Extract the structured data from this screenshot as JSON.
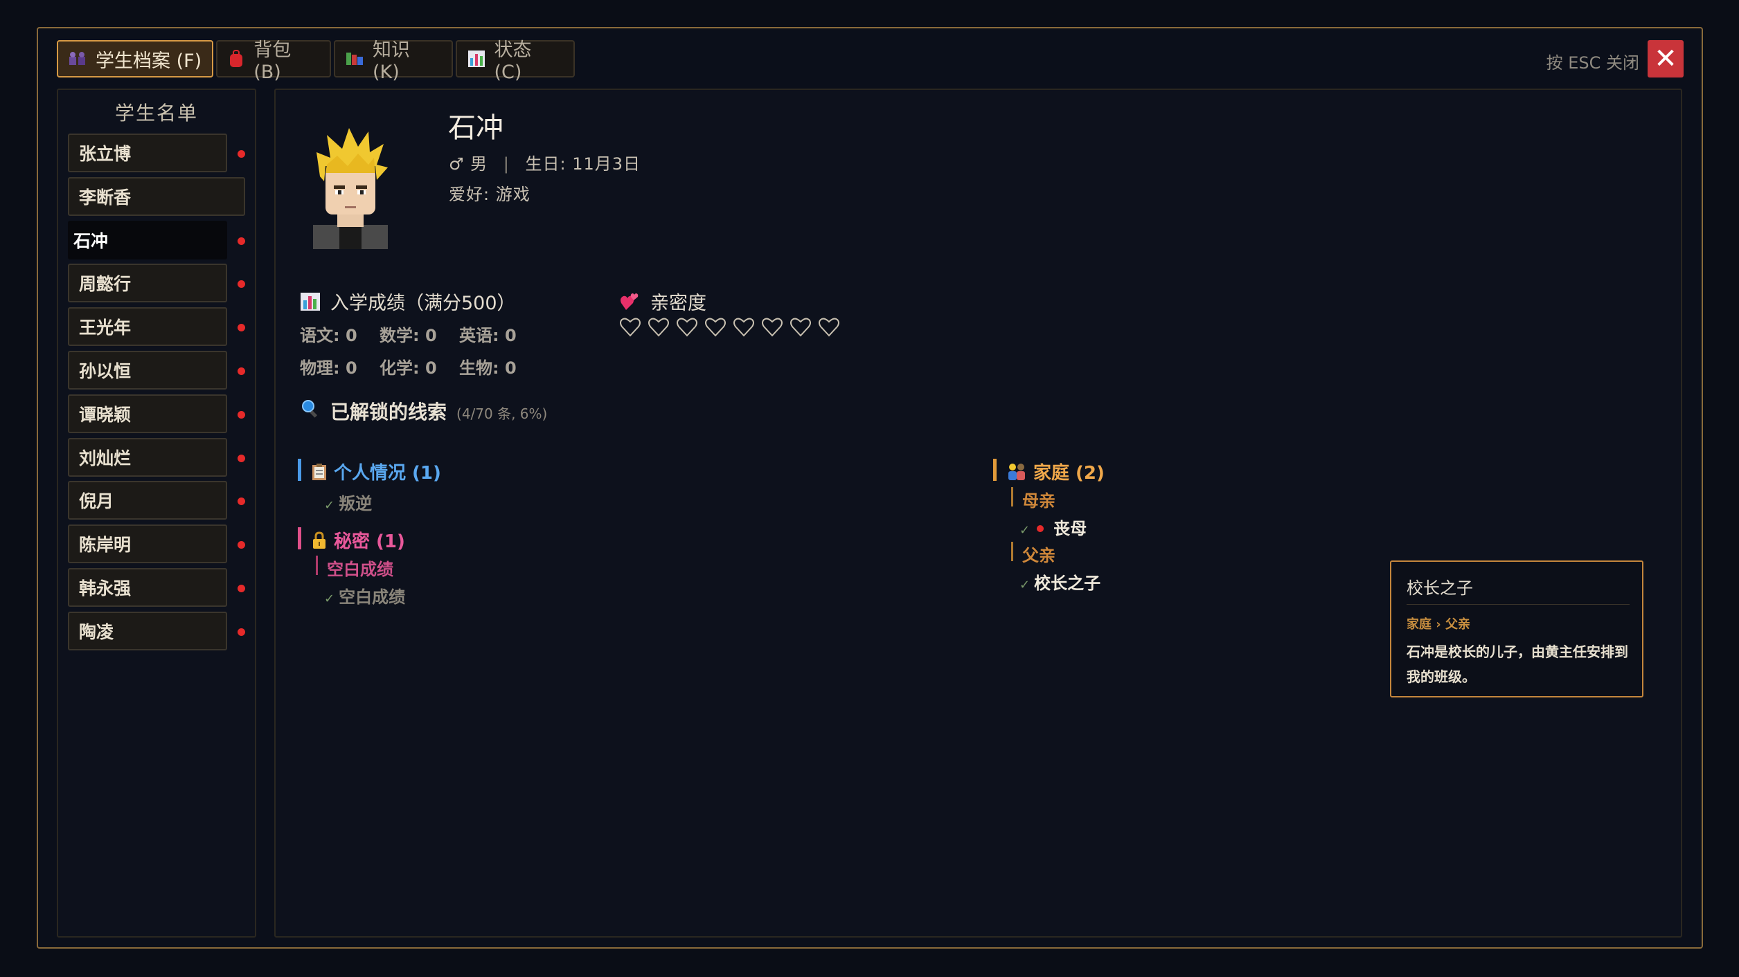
{
  "tabs": [
    {
      "label": "学生档案 (F)",
      "icon": "students-icon",
      "active": true
    },
    {
      "label": "背包 (B)",
      "icon": "backpack-icon",
      "active": false
    },
    {
      "label": "知识 (K)",
      "icon": "books-icon",
      "active": false
    },
    {
      "label": "状态 (C)",
      "icon": "chart-icon",
      "active": false
    }
  ],
  "esc_hint": "按 ESC 关闭",
  "close_icon": "✕",
  "sidebar": {
    "title": "学生名单",
    "students": [
      {
        "name": "张立博",
        "dot": true
      },
      {
        "name": "李断香",
        "dot": false
      },
      {
        "name": "石冲",
        "dot": true,
        "selected": true
      },
      {
        "name": "周懿行",
        "dot": true
      },
      {
        "name": "王光年",
        "dot": true
      },
      {
        "name": "孙以恒",
        "dot": true
      },
      {
        "name": "谭晓颖",
        "dot": true
      },
      {
        "name": "刘灿烂",
        "dot": true
      },
      {
        "name": "倪月",
        "dot": true
      },
      {
        "name": "陈岸明",
        "dot": true
      },
      {
        "name": "韩永强",
        "dot": true
      },
      {
        "name": "陶凌",
        "dot": true
      }
    ]
  },
  "profile": {
    "name": "石冲",
    "gender_symbol": "♂",
    "gender": "男",
    "birthday": "生日: 11月3日",
    "hobby": "爱好: 游戏"
  },
  "scores": {
    "title": "入学成绩（满分500）",
    "rows": [
      [
        "语文: 0",
        "数学: 0",
        "英语: 0"
      ],
      [
        "物理: 0",
        "化学: 0",
        "生物: 0"
      ]
    ]
  },
  "affinity": {
    "title": "亲密度",
    "hearts_total": 8,
    "hearts_filled": 0
  },
  "clues": {
    "title": "已解锁的线索",
    "count": "(4/70 条, 6%)",
    "personal": {
      "title": "个人情况 (1)",
      "items": [
        "叛逆"
      ]
    },
    "secret": {
      "title": "秘密 (1)",
      "sub": "空白成绩",
      "items": [
        "空白成绩"
      ]
    },
    "family": {
      "title": "家庭 (2)",
      "mother": {
        "label": "母亲",
        "items": [
          "丧母"
        ]
      },
      "father": {
        "label": "父亲",
        "items": [
          "校长之子"
        ]
      }
    }
  },
  "tooltip": {
    "title": "校长之子",
    "path": "家庭 › 父亲",
    "body": "石冲是校长的儿子，由黄主任安排到我的班级。"
  },
  "colors": {
    "accent": "#d79a45",
    "dot_red": "#e62a2a",
    "personal_blue": "#4a9ae8",
    "secret_pink": "#e0508a",
    "family_orange": "#e09a3a",
    "close_red": "#c9343a"
  }
}
